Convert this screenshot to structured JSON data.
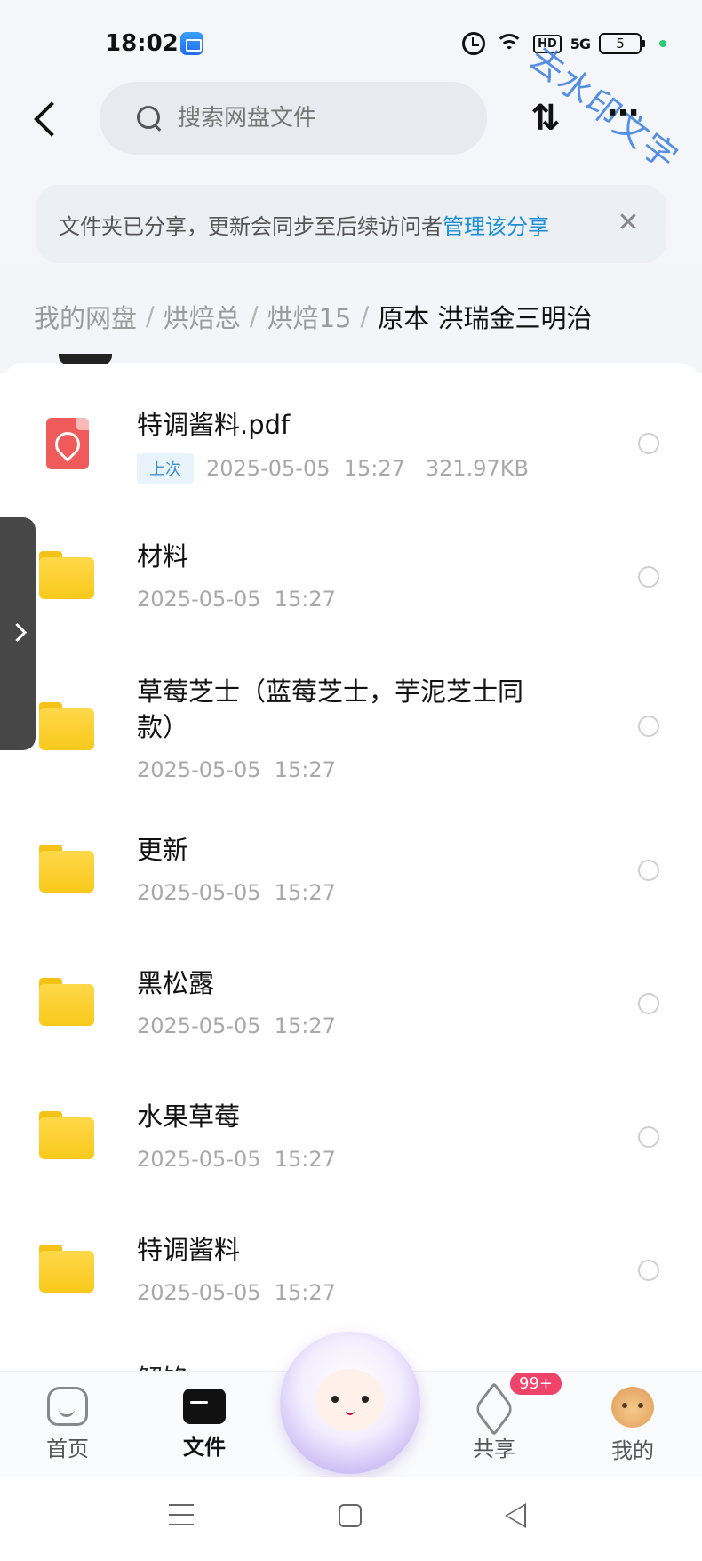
{
  "status_bar": {
    "time": "18:02",
    "network": "5G",
    "battery": "5",
    "watermark": "去水印文字"
  },
  "header": {
    "search_placeholder": "搜索网盘文件",
    "sort_label": "⇅",
    "more_label": "⋯"
  },
  "banner": {
    "text": "文件夹已分享，更新会同步至后续访问者",
    "action": "管理该分享",
    "close": "✕"
  },
  "breadcrumb": [
    "我的网盘",
    "烘焙总",
    "烘焙15",
    "原本 洪瑞金三明治"
  ],
  "files": [
    {
      "name": "特调酱料.pdf",
      "type": "pdf",
      "tag": "上次",
      "date": "2025-05-05",
      "time": "15:27",
      "size": "321.97KB"
    },
    {
      "name": "材料",
      "type": "folder",
      "date": "2025-05-05",
      "time": "15:27"
    },
    {
      "name_line1": "草莓芝士（蓝莓芝士，芋泥芝士同",
      "name_line2": "款）",
      "type": "folder",
      "date": "2025-05-05",
      "time": "15:27"
    },
    {
      "name": "更新",
      "type": "folder",
      "date": "2025-05-05",
      "time": "15:27"
    },
    {
      "name": "黑松露",
      "type": "folder",
      "date": "2025-05-05",
      "time": "15:27"
    },
    {
      "name": "水果草莓",
      "type": "folder",
      "date": "2025-05-05",
      "time": "15:27"
    },
    {
      "name": "特调酱料",
      "type": "folder",
      "date": "2025-05-05",
      "time": "15:27"
    }
  ],
  "partial_next": "解馅",
  "tabbar": {
    "home": "首页",
    "files": "文件",
    "share": "共享",
    "share_badge": "99+",
    "me": "我的"
  }
}
